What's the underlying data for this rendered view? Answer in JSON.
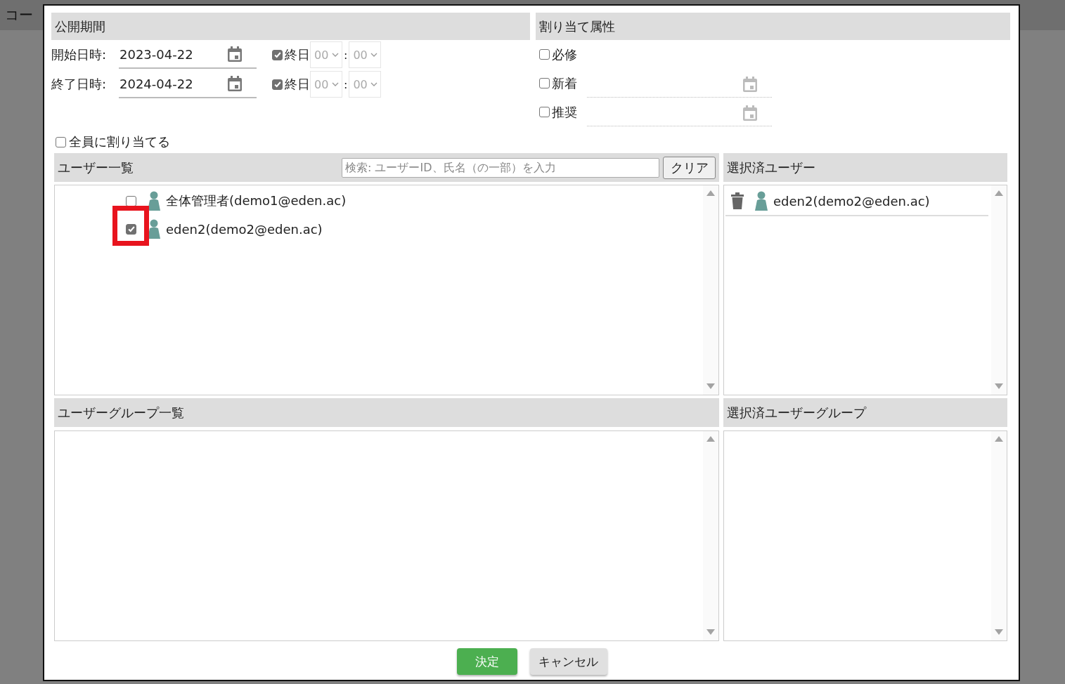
{
  "background": {
    "title": "コー"
  },
  "period": {
    "title": "公開期間",
    "rows": [
      {
        "label": "開始日時:",
        "date": "2023-04-22",
        "all_day": {
          "label": "終日",
          "checked": true
        },
        "hour": "00",
        "separator": ":",
        "minute": "00"
      },
      {
        "label": "終了日時:",
        "date": "2024-04-22",
        "all_day": {
          "label": "終日",
          "checked": true
        },
        "hour": "00",
        "separator": ":",
        "minute": "00"
      }
    ]
  },
  "attributes": {
    "title": "割り当て属性",
    "items": [
      {
        "label": "必修",
        "checked": false,
        "kind": "plain"
      },
      {
        "label": "新着",
        "checked": false,
        "kind": "date"
      },
      {
        "label": "推奨",
        "checked": false,
        "kind": "date"
      }
    ]
  },
  "assign_all": {
    "label": "全員に割り当てる",
    "checked": false
  },
  "user_list": {
    "title": "ユーザー一覧",
    "search": {
      "placeholder": "検索: ユーザーID、氏名（の一部）を入力"
    },
    "clear_button": "クリア",
    "users": [
      {
        "name": "全体管理者(demo1@eden.ac)",
        "checked": false,
        "highlighted": false
      },
      {
        "name": "eden2(demo2@eden.ac)",
        "checked": true,
        "highlighted": true
      }
    ]
  },
  "selected_users": {
    "title": "選択済ユーザー",
    "users": [
      "eden2(demo2@eden.ac)"
    ]
  },
  "group_list": {
    "title": "ユーザーグループ一覧"
  },
  "selected_groups": {
    "title": "選択済ユーザーグループ"
  },
  "buttons": [
    {
      "label": "決定",
      "kind": "primary"
    },
    {
      "label": "キャンセル",
      "kind": "secondary"
    }
  ]
}
